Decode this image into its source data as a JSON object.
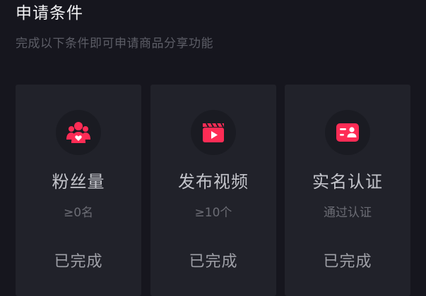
{
  "header": {
    "title": "申请条件",
    "subtitle": "完成以下条件即可申请商品分享功能"
  },
  "colors": {
    "accent": "#fe2c55",
    "background": "#16161e",
    "card": "#21222a"
  },
  "cards": [
    {
      "icon": "fans-icon",
      "label": "粉丝量",
      "requirement": "≥0名",
      "status": "已完成"
    },
    {
      "icon": "video-clapper-icon",
      "label": "发布视频",
      "requirement": "≥10个",
      "status": "已完成"
    },
    {
      "icon": "id-card-icon",
      "label": "实名认证",
      "requirement": "通过认证",
      "status": "已完成"
    }
  ]
}
